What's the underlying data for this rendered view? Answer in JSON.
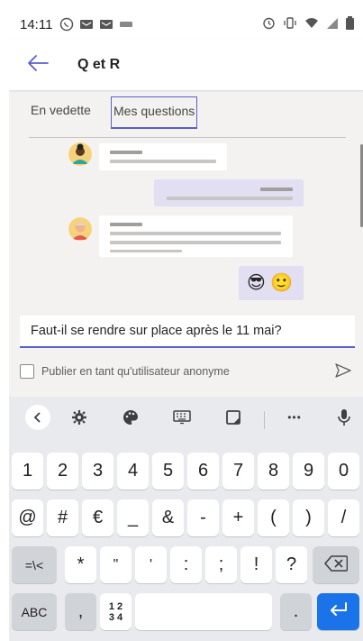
{
  "status_bar": {
    "time": "14:11"
  },
  "header": {
    "title": "Q et R",
    "back_icon": "arrow-left-icon"
  },
  "tabs": [
    {
      "label": "En vedette",
      "selected": false
    },
    {
      "label": "Mes questions",
      "selected": true
    }
  ],
  "feed": {
    "messages": [
      {
        "emoji": ""
      },
      {
        "emoji": ""
      },
      {
        "emoji": ""
      },
      {
        "emoji": "😎 🙂"
      }
    ]
  },
  "composer": {
    "value": "Faut-il se rendre sur place après le 11 mai?"
  },
  "anonymous": {
    "label": "Publier en tant qu'utilisateur anonyme",
    "checked": false
  },
  "keyboard": {
    "toolbar": [
      "chevron-left-icon",
      "settings-icon",
      "palette-icon",
      "keyboard-icon",
      "clipboard-icon",
      "more-icon",
      "mic-icon"
    ],
    "more_label": "•••",
    "row1": [
      "1",
      "2",
      "3",
      "4",
      "5",
      "6",
      "7",
      "8",
      "9",
      "0"
    ],
    "row2": [
      "@",
      "#",
      "€",
      "_",
      "&",
      "-",
      "+",
      "(",
      ")",
      "/"
    ],
    "row3": [
      "=\\<",
      "*",
      "\"",
      "'",
      ":",
      ";",
      "!",
      "?"
    ],
    "row4_abc": "ABC",
    "row4_comma": ",",
    "row4_num_top": "1 2",
    "row4_num_bottom": "3 4",
    "row4_period": ".",
    "accent_color": "#1a73e8"
  },
  "theme": {
    "accent": "#5b5fc7",
    "bubble_mine": "#e1dff1"
  }
}
